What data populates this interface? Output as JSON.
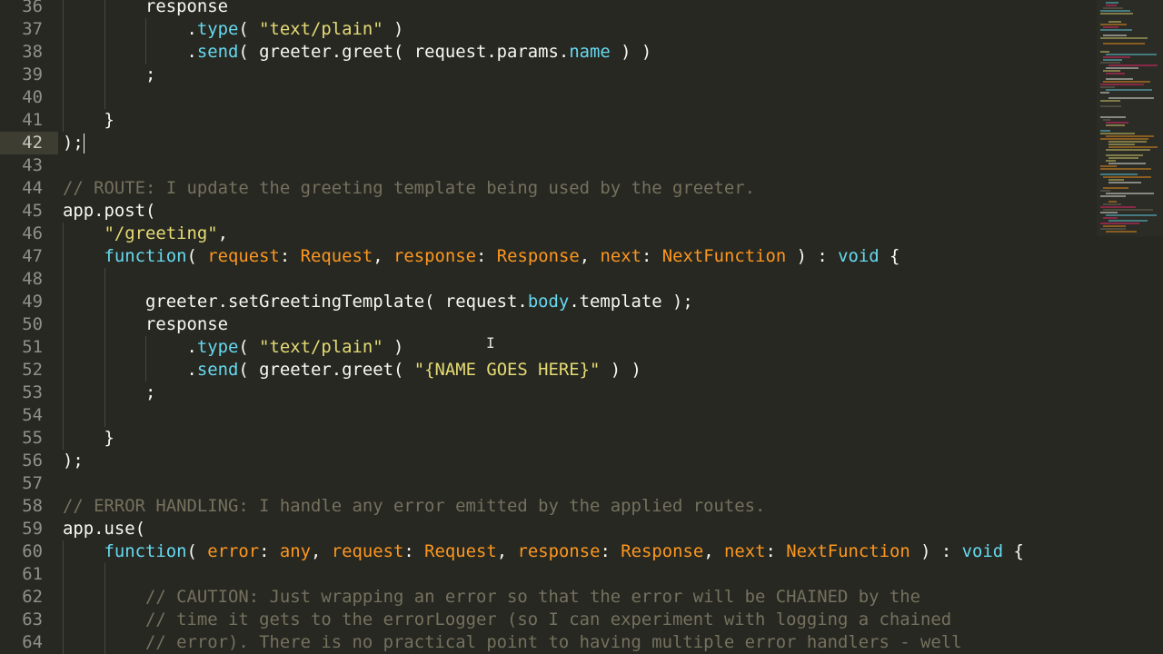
{
  "editor": {
    "current_line": 42,
    "lines": [
      {
        "n": "36",
        "indent": 2,
        "t": [
          [
            "p",
            "response"
          ]
        ]
      },
      {
        "n": "37",
        "indent": 3,
        "t": [
          [
            "p",
            "."
          ],
          [
            "k",
            "type"
          ],
          [
            "p",
            "( "
          ],
          [
            "s",
            "\"text/plain\""
          ],
          [
            "p",
            " )"
          ]
        ]
      },
      {
        "n": "38",
        "indent": 3,
        "t": [
          [
            "p",
            "."
          ],
          [
            "k",
            "send"
          ],
          [
            "p",
            "( greeter.greet( request.params."
          ],
          [
            "k",
            "name"
          ],
          [
            "p",
            " ) )"
          ]
        ]
      },
      {
        "n": "39",
        "indent": 2,
        "t": [
          [
            "p",
            ";"
          ]
        ]
      },
      {
        "n": "40",
        "indent": 2,
        "t": []
      },
      {
        "n": "41",
        "indent": 1,
        "t": [
          [
            "p",
            "}"
          ]
        ]
      },
      {
        "n": "42",
        "indent": 0,
        "t": [
          [
            "p",
            ");"
          ]
        ]
      },
      {
        "n": "43",
        "indent": 0,
        "t": []
      },
      {
        "n": "44",
        "indent": 0,
        "t": [
          [
            "c",
            "// ROUTE: I update the greeting template being used by the greeter."
          ]
        ]
      },
      {
        "n": "45",
        "indent": 0,
        "t": [
          [
            "p",
            "app.post("
          ]
        ]
      },
      {
        "n": "46",
        "indent": 1,
        "t": [
          [
            "s",
            "\"/greeting\""
          ],
          [
            "p",
            ","
          ]
        ]
      },
      {
        "n": "47",
        "indent": 1,
        "t": [
          [
            "k",
            "function"
          ],
          [
            "p",
            "( "
          ],
          [
            "o",
            "request"
          ],
          [
            "p",
            ": "
          ],
          [
            "o",
            "Request"
          ],
          [
            "p",
            ", "
          ],
          [
            "o",
            "response"
          ],
          [
            "p",
            ": "
          ],
          [
            "o",
            "Response"
          ],
          [
            "p",
            ", "
          ],
          [
            "o",
            "next"
          ],
          [
            "p",
            ": "
          ],
          [
            "o",
            "NextFunction"
          ],
          [
            "p",
            " ) : "
          ],
          [
            "k",
            "void"
          ],
          [
            "p",
            " {"
          ]
        ]
      },
      {
        "n": "48",
        "indent": 2,
        "t": []
      },
      {
        "n": "49",
        "indent": 2,
        "t": [
          [
            "p",
            "greeter.setGreetingTemplate( request."
          ],
          [
            "k",
            "body"
          ],
          [
            "p",
            ".template );"
          ]
        ]
      },
      {
        "n": "50",
        "indent": 2,
        "t": [
          [
            "p",
            "response"
          ]
        ]
      },
      {
        "n": "51",
        "indent": 3,
        "t": [
          [
            "p",
            "."
          ],
          [
            "k",
            "type"
          ],
          [
            "p",
            "( "
          ],
          [
            "s",
            "\"text/plain\""
          ],
          [
            "p",
            " )"
          ]
        ]
      },
      {
        "n": "52",
        "indent": 3,
        "t": [
          [
            "p",
            "."
          ],
          [
            "k",
            "send"
          ],
          [
            "p",
            "( greeter.greet( "
          ],
          [
            "s",
            "\"{NAME GOES HERE}\""
          ],
          [
            "p",
            " ) )"
          ]
        ]
      },
      {
        "n": "53",
        "indent": 2,
        "t": [
          [
            "p",
            ";"
          ]
        ]
      },
      {
        "n": "54",
        "indent": 2,
        "t": []
      },
      {
        "n": "55",
        "indent": 1,
        "t": [
          [
            "p",
            "}"
          ]
        ]
      },
      {
        "n": "56",
        "indent": 0,
        "t": [
          [
            "p",
            ");"
          ]
        ]
      },
      {
        "n": "57",
        "indent": 0,
        "t": []
      },
      {
        "n": "58",
        "indent": 0,
        "t": [
          [
            "c",
            "// ERROR HANDLING: I handle any error emitted by the applied routes."
          ]
        ]
      },
      {
        "n": "59",
        "indent": 0,
        "t": [
          [
            "p",
            "app.use("
          ]
        ]
      },
      {
        "n": "60",
        "indent": 1,
        "t": [
          [
            "k",
            "function"
          ],
          [
            "p",
            "( "
          ],
          [
            "o",
            "error"
          ],
          [
            "p",
            ": "
          ],
          [
            "o",
            "any"
          ],
          [
            "p",
            ", "
          ],
          [
            "o",
            "request"
          ],
          [
            "p",
            ": "
          ],
          [
            "o",
            "Request"
          ],
          [
            "p",
            ", "
          ],
          [
            "o",
            "response"
          ],
          [
            "p",
            ": "
          ],
          [
            "o",
            "Response"
          ],
          [
            "p",
            ", "
          ],
          [
            "o",
            "next"
          ],
          [
            "p",
            ": "
          ],
          [
            "o",
            "NextFunction"
          ],
          [
            "p",
            " ) : "
          ],
          [
            "k",
            "void"
          ],
          [
            "p",
            " {"
          ]
        ]
      },
      {
        "n": "61",
        "indent": 2,
        "t": []
      },
      {
        "n": "62",
        "indent": 2,
        "t": [
          [
            "c",
            "// CAUTION: Just wrapping an error so that the error will be CHAINED by the"
          ]
        ]
      },
      {
        "n": "63",
        "indent": 2,
        "t": [
          [
            "c",
            "// time it gets to the errorLogger (so I can experiment with logging a chained"
          ]
        ]
      },
      {
        "n": "64",
        "indent": 2,
        "t": [
          [
            "c",
            "// error). There is no practical point to having multiple error handlers - well"
          ]
        ]
      }
    ]
  }
}
